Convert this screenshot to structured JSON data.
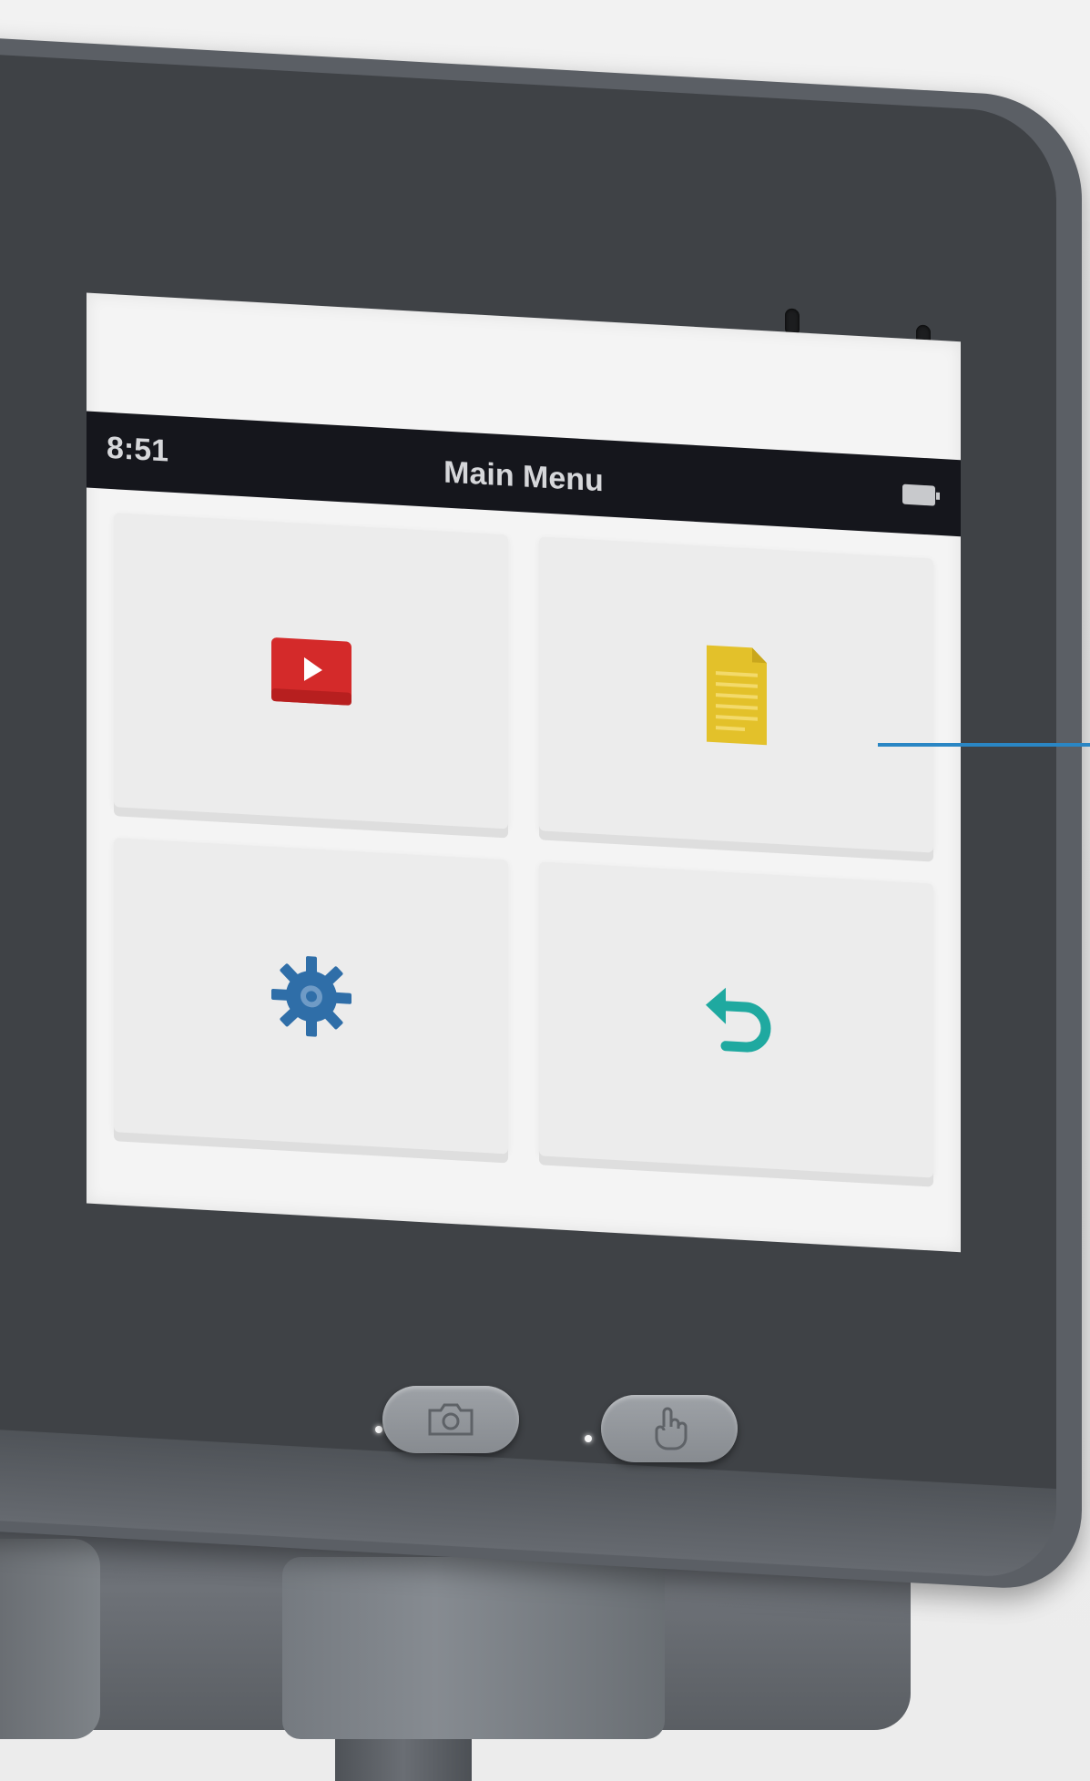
{
  "screen": {
    "status_bar": {
      "time": "8:51",
      "title": "Main Menu",
      "battery_icon": "battery-icon"
    },
    "tiles": [
      {
        "icon": "video-play-icon",
        "icon_color": "#d42a2a"
      },
      {
        "icon": "document-icon",
        "icon_color": "#e3c12a"
      },
      {
        "icon": "gear-icon",
        "icon_color": "#2f6ea8"
      },
      {
        "icon": "undo-arrow-icon",
        "icon_color": "#1fa9a0"
      }
    ]
  },
  "hardware_buttons": [
    {
      "icon": "camera-icon"
    },
    {
      "icon": "hand-touch-icon"
    }
  ],
  "colors": {
    "status_bar": "#15161c",
    "callout": "#2a86c4"
  }
}
